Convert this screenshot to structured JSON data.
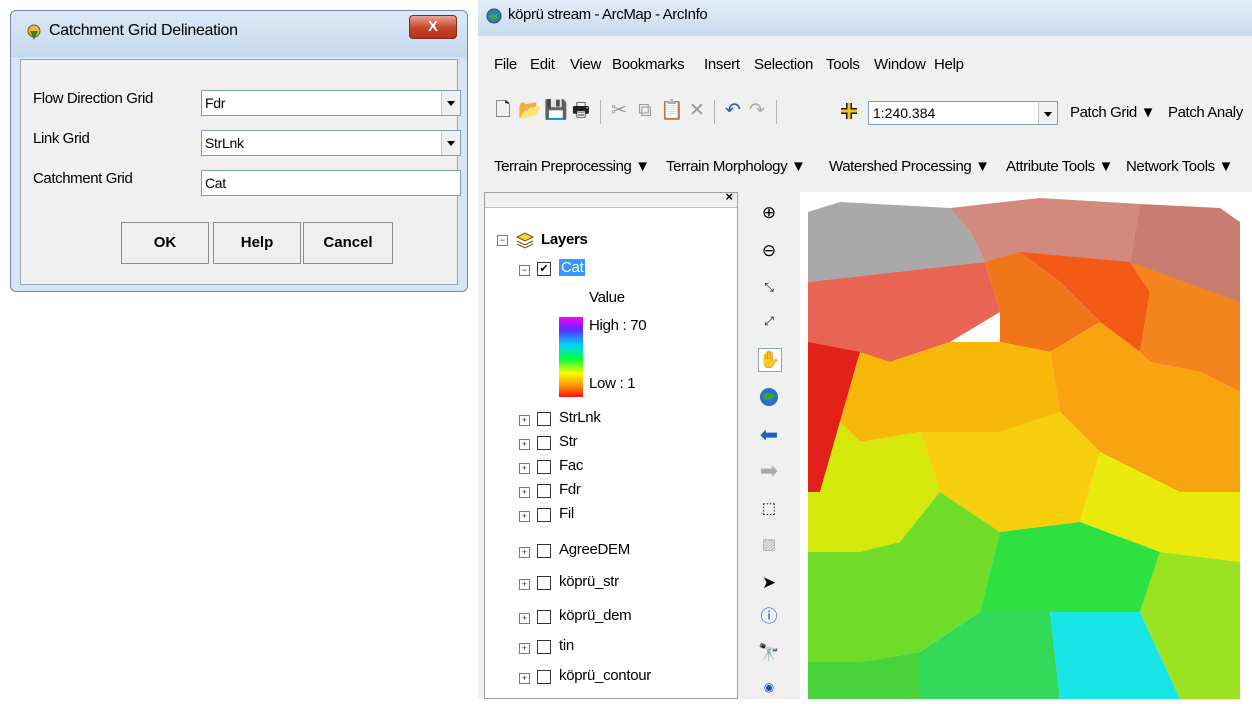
{
  "dialog": {
    "title": "Catchment Grid Delineation",
    "close_label": "X",
    "fields": [
      {
        "label": "Flow Direction Grid",
        "value": "Fdr"
      },
      {
        "label": "Link Grid",
        "value": "StrLnk"
      },
      {
        "label": "Catchment Grid",
        "value": "Cat"
      }
    ],
    "buttons": {
      "ok": "OK",
      "help": "Help",
      "cancel": "Cancel"
    }
  },
  "arcmap": {
    "title": "köprü stream - ArcMap - ArcInfo",
    "menu": [
      "File",
      "Edit",
      "View",
      "Bookmarks",
      "Insert",
      "Selection",
      "Tools",
      "Window",
      "Help"
    ],
    "scale": "1:240.384",
    "toolbar1_labels": [
      "Patch Grid ▼",
      "Patch Analy"
    ],
    "toolbar2_labels": [
      "Terrain Preprocessing ▼",
      "Terrain Morphology ▼",
      "Watershed Processing ▼",
      "Attribute Tools ▼",
      "Network Tools ▼"
    ],
    "toc": {
      "root": "Layers",
      "active_layer": "Cat",
      "legend_title": "Value",
      "legend_high": "High : 70",
      "legend_low": "Low : 1",
      "layers": [
        "StrLnk",
        "Str",
        "Fac",
        "Fdr",
        "Fil",
        "AgreeDEM",
        "köprü_str",
        "köprü_dem",
        "tin",
        "köprü_contour"
      ]
    }
  },
  "colors": {
    "dialog_bg": "#d7e4f2",
    "close_red": "#c7432a",
    "selection_blue": "#3399ff"
  }
}
